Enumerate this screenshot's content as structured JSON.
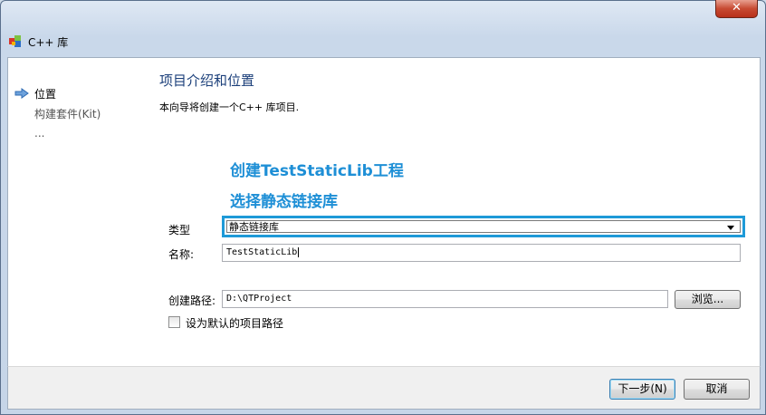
{
  "window": {
    "title": "C++ 库",
    "close_glyph": "✕"
  },
  "steps": [
    {
      "label": "位置",
      "active": true
    },
    {
      "label": "构建套件(Kit)",
      "active": false
    },
    {
      "label": "...",
      "active": false
    }
  ],
  "page": {
    "title": "项目介绍和位置",
    "description": "本向导将创建一个C++ 库项目."
  },
  "annotations": {
    "line1": "创建TestStaticLib工程",
    "line2": "选择静态链接库"
  },
  "form": {
    "type_label": "类型",
    "type_value": "静态链接库",
    "name_label": "名称:",
    "name_value": "TestStaticLib",
    "path_label": "创建路径:",
    "path_value": "D:\\QTProject",
    "browse_label": "浏览...",
    "default_path_label": "设为默认的项目路径",
    "default_path_checked": false
  },
  "footer": {
    "next_label": "下一步(N)",
    "cancel_label": "取消"
  },
  "colors": {
    "annotation": "#1e8fd6",
    "highlight_border": "#1e9ad8",
    "title": "#1b3f7a"
  },
  "icons": {
    "app": "qt-creator-cube-icon",
    "step_arrow": "right-arrow-icon",
    "combo_dropdown": "chevron-down-icon"
  }
}
